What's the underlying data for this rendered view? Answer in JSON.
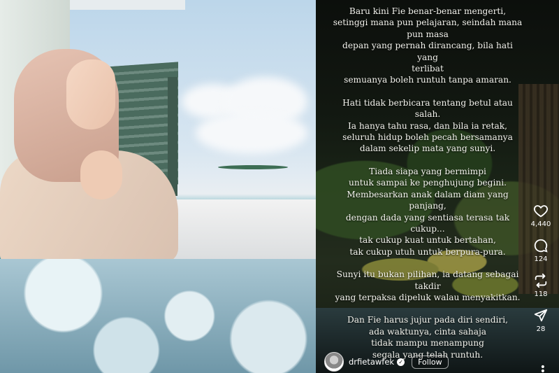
{
  "caption": {
    "paragraphs": [
      "Baru kini Fie benar-benar mengerti,\nsetinggi mana pun pelajaran, seindah mana\npun masa\ndepan yang pernah dirancang, bila hati yang\nterlibat\nsemuanya boleh runtuh tanpa amaran.",
      "Hati tidak berbicara tentang betul atau salah.\nIa hanya tahu rasa, dan bila ia retak,\nseluruh hidup boleh pecah bersamanya\ndalam sekelip mata yang sunyi.",
      "Tiada siapa yang bermimpi\nuntuk sampai ke penghujung begini.\nMembesarkan anak dalam diam yang\npanjang,\ndengan dada yang sentiasa terasa tak cukup...\ntak cukup kuat untuk bertahan,\ntak cukup utuh untuk berpura-pura.",
      "Sunyi itu bukan pilihan, ia datang sebagai\ntakdir\nyang terpaksa dipeluk walau menyakitkan.",
      "Dan Fie harus jujur pada diri sendiri,\nada waktunya, cinta sahaja\ntidak mampu menampung\nsegala yang telah runtuh."
    ]
  },
  "actions": {
    "like": {
      "icon": "heart-icon",
      "count": "4,440"
    },
    "comment": {
      "icon": "comment-icon",
      "count": "124"
    },
    "repost": {
      "icon": "repost-icon",
      "count": "118"
    },
    "share": {
      "icon": "share-icon",
      "count": "28"
    }
  },
  "author": {
    "handle": "drfietawfek",
    "follow_label": "Follow"
  },
  "more_label": "•\n•\n•"
}
